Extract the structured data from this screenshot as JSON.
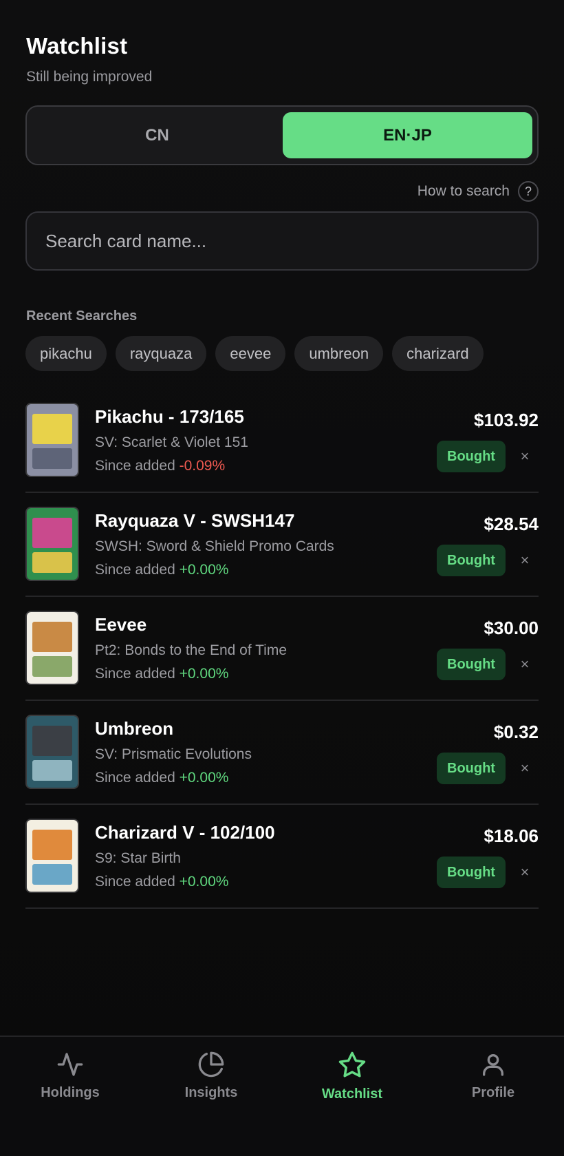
{
  "header": {
    "title": "Watchlist",
    "subtitle": "Still being improved"
  },
  "region_toggle": {
    "options": [
      "CN",
      "EN·JP"
    ],
    "selected": "EN·JP"
  },
  "help": {
    "label": "How to search",
    "icon": "question-icon",
    "glyph": "?"
  },
  "search": {
    "placeholder": "Search card name...",
    "value": ""
  },
  "recent": {
    "title": "Recent Searches",
    "items": [
      "pikachu",
      "rayquaza",
      "eevee",
      "umbreon",
      "charizard"
    ]
  },
  "since_label": "Since added",
  "bought_label": "Bought",
  "remove_glyph": "×",
  "cards": [
    {
      "name": "Pikachu - 173/165",
      "set": "SV: Scarlet & Violet 151",
      "change": "-0.09%",
      "change_dir": "neg",
      "price": "$103.92",
      "thumb_colors": [
        "#8b8fa3",
        "#e8d24a",
        "#5e6478"
      ]
    },
    {
      "name": "Rayquaza V - SWSH147",
      "set": "SWSH: Sword & Shield Promo Cards",
      "change": "+0.00%",
      "change_dir": "pos",
      "price": "$28.54",
      "thumb_colors": [
        "#2f8f4e",
        "#c94a8d",
        "#d9c24a"
      ]
    },
    {
      "name": "Eevee",
      "set": "Pt2: Bonds to the End of Time",
      "change": "+0.00%",
      "change_dir": "pos",
      "price": "$30.00",
      "thumb_colors": [
        "#f2efe6",
        "#c98a45",
        "#8aa86a"
      ]
    },
    {
      "name": "Umbreon",
      "set": "SV: Prismatic Evolutions",
      "change": "+0.00%",
      "change_dir": "pos",
      "price": "$0.32",
      "thumb_colors": [
        "#2e5a68",
        "#3b3f45",
        "#8fb4bf"
      ]
    },
    {
      "name": "Charizard V - 102/100",
      "set": "S9: Star Birth",
      "change": "+0.00%",
      "change_dir": "pos",
      "price": "$18.06",
      "thumb_colors": [
        "#f3efe2",
        "#e08a3c",
        "#6aa7c7"
      ]
    }
  ],
  "colors": {
    "accent": "#66dd86",
    "negative": "#ef5a51",
    "background": "#0b0b0b"
  },
  "tabs": [
    {
      "label": "Holdings",
      "icon": "activity-icon",
      "active": false
    },
    {
      "label": "Insights",
      "icon": "pie-chart-icon",
      "active": false
    },
    {
      "label": "Watchlist",
      "icon": "star-icon",
      "active": true
    },
    {
      "label": "Profile",
      "icon": "user-icon",
      "active": false
    }
  ]
}
